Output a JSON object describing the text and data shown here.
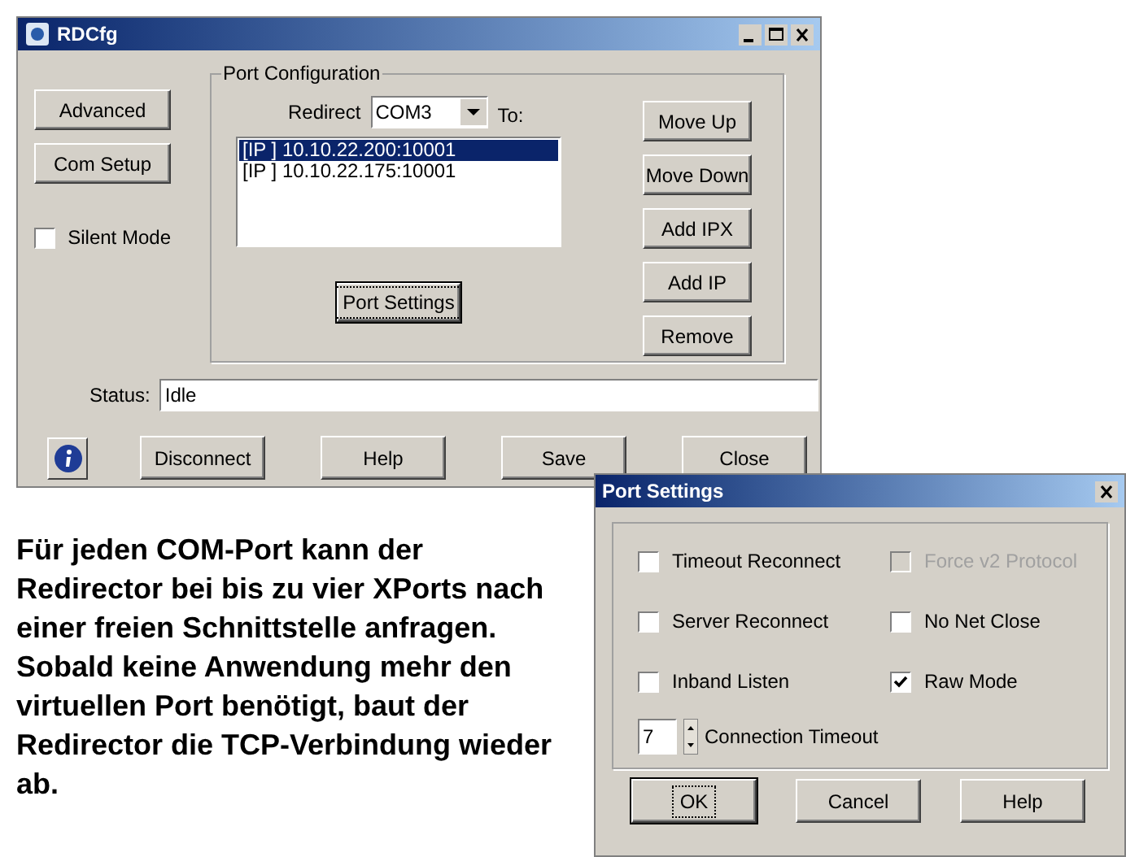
{
  "main_window": {
    "title": "RDCfg",
    "left_buttons": [
      {
        "label": "Advanced"
      },
      {
        "label": "Com Setup"
      }
    ],
    "silent_mode": {
      "label": "Silent Mode",
      "checked": false
    },
    "port_configuration": {
      "title": "Port Configuration",
      "redirect_label": "Redirect",
      "redirect_value": "COM3",
      "to_label": "To:",
      "list": [
        {
          "text": "[IP ] 10.10.22.200:10001",
          "selected": true
        },
        {
          "text": "[IP ] 10.10.22.175:10001",
          "selected": false
        }
      ],
      "port_settings_button": {
        "label": "Port Settings",
        "focused": true
      },
      "side_buttons": [
        {
          "label": "Move Up"
        },
        {
          "label": "Move Down"
        },
        {
          "label": "Add IPX"
        },
        {
          "label": "Add IP"
        },
        {
          "label": "Remove"
        }
      ]
    },
    "status": {
      "label": "Status:",
      "value": "Idle"
    },
    "bottom_buttons": [
      {
        "label": "Disconnect"
      },
      {
        "label": "Help"
      },
      {
        "label": "Save"
      },
      {
        "label": "Close"
      }
    ]
  },
  "port_settings": {
    "title": "Port Settings",
    "options": [
      {
        "label": "Timeout Reconnect",
        "checked": false,
        "disabled": false
      },
      {
        "label": "Force v2 Protocol",
        "checked": false,
        "disabled": true
      },
      {
        "label": "Server Reconnect",
        "checked": false,
        "disabled": false
      },
      {
        "label": "No Net Close",
        "checked": false,
        "disabled": false
      },
      {
        "label": "Inband Listen",
        "checked": false,
        "disabled": false
      },
      {
        "label": "Raw Mode",
        "checked": true,
        "disabled": false
      }
    ],
    "timeout": {
      "value": "7",
      "label": "Connection Timeout"
    },
    "buttons": [
      {
        "label": "OK",
        "focused": true
      },
      {
        "label": "Cancel",
        "focused": false
      },
      {
        "label": "Help",
        "focused": false
      }
    ]
  },
  "caption": "Für jeden COM-Port kann der Redirector bei bis zu vier XPorts nach einer freien Schnittstelle anfragen. Sobald keine Anwendung mehr den virtuellen Port benötigt, baut der Redirector die TCP-Verbindung wieder ab."
}
